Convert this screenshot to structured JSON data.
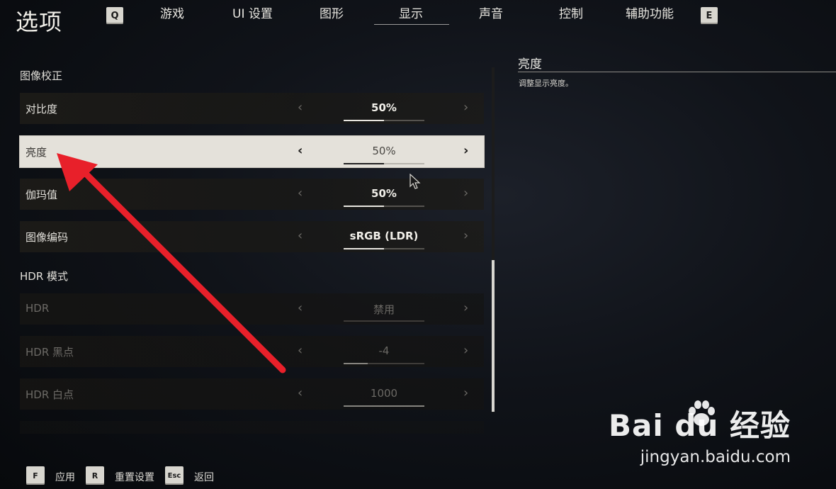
{
  "header": {
    "title": "选项",
    "left_key": "Q",
    "right_key": "E",
    "tabs": [
      {
        "label": "游戏"
      },
      {
        "label": "UI 设置"
      },
      {
        "label": "图形"
      },
      {
        "label": "显示",
        "active": true
      },
      {
        "label": "声音"
      },
      {
        "label": "控制"
      },
      {
        "label": "辅助功能"
      }
    ]
  },
  "sections": {
    "image_calibration": "图像校正",
    "hdr_mode": "HDR 模式"
  },
  "settings": [
    {
      "label": "对比度",
      "value": "50%",
      "fill": 0.5
    },
    {
      "label": "亮度",
      "value": "50%",
      "fill": 0.5,
      "selected": true
    },
    {
      "label": "伽玛值",
      "value": "50%",
      "fill": 0.5
    },
    {
      "label": "图像编码",
      "value": "sRGB (LDR)",
      "fill": 0.5
    },
    {
      "label": "HDR",
      "value": "禁用",
      "fill": 0.0,
      "disabled": true
    },
    {
      "label": "HDR 黑点",
      "value": "-4",
      "fill": 0.3,
      "disabled": true
    },
    {
      "label": "HDR 白点",
      "value": "1000",
      "fill": 1.0,
      "disabled": true
    }
  ],
  "description": {
    "title": "亮度",
    "text": "调整显示亮度。"
  },
  "footer": [
    {
      "key": "F",
      "label": "应用"
    },
    {
      "key": "R",
      "label": "重置设置"
    },
    {
      "key": "Esc",
      "label": "返回"
    }
  ],
  "arrows": {
    "left": "‹",
    "right": "›"
  },
  "colors": {
    "annotation": "#e8202a",
    "selected_row": "#e4e1da"
  },
  "watermark": {
    "brand": "Bai du 经验",
    "url": "jingyan.baidu.com"
  }
}
